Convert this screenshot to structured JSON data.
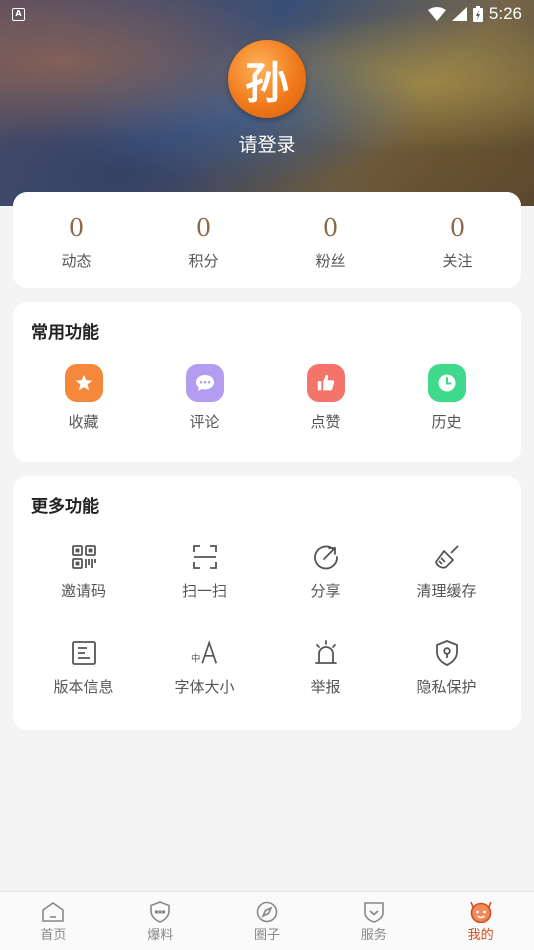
{
  "status_bar": {
    "time": "5:26",
    "app_badge": "A"
  },
  "profile": {
    "avatar_glyph": "孙",
    "login_label": "请登录"
  },
  "stats": [
    {
      "value": "0",
      "label": "动态"
    },
    {
      "value": "0",
      "label": "积分"
    },
    {
      "value": "0",
      "label": "粉丝"
    },
    {
      "value": "0",
      "label": "关注"
    }
  ],
  "common_functions": {
    "title": "常用功能",
    "items": [
      {
        "label": "收藏",
        "icon": "star-icon",
        "color": "#f5883a"
      },
      {
        "label": "评论",
        "icon": "comment-icon",
        "color": "#b49cf0"
      },
      {
        "label": "点赞",
        "icon": "thumbs-up-icon",
        "color": "#f4736a"
      },
      {
        "label": "历史",
        "icon": "clock-icon",
        "color": "#3fd98c"
      }
    ]
  },
  "more_functions": {
    "title": "更多功能",
    "items": [
      {
        "label": "邀请码",
        "icon": "qr-code-icon"
      },
      {
        "label": "扫一扫",
        "icon": "scan-icon"
      },
      {
        "label": "分享",
        "icon": "share-icon"
      },
      {
        "label": "清理缓存",
        "icon": "broom-icon"
      },
      {
        "label": "版本信息",
        "icon": "document-icon"
      },
      {
        "label": "字体大小",
        "icon": "font-size-icon"
      },
      {
        "label": "举报",
        "icon": "alarm-icon"
      },
      {
        "label": "隐私保护",
        "icon": "shield-lock-icon"
      }
    ]
  },
  "bottom_nav": [
    {
      "label": "首页",
      "icon": "home-icon",
      "active": false
    },
    {
      "label": "爆料",
      "icon": "tip-shield-icon",
      "active": false
    },
    {
      "label": "圈子",
      "icon": "compass-icon",
      "active": false
    },
    {
      "label": "服务",
      "icon": "service-shield-icon",
      "active": false
    },
    {
      "label": "我的",
      "icon": "me-face-icon",
      "active": true
    }
  ],
  "colors": {
    "accent": "#d84a1a",
    "stat_value": "#8b6a4a",
    "icon_stroke": "#555555"
  }
}
